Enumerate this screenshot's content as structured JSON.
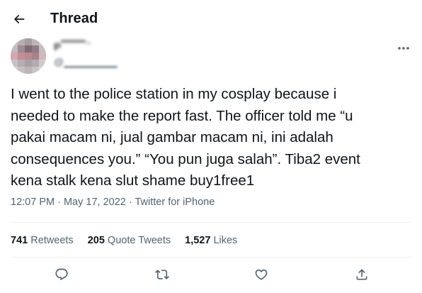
{
  "header": {
    "title": "Thread",
    "back_icon": "arrow-left-icon"
  },
  "author": {
    "display_name": "P▔▔▔ ̈",
    "handle": "@▁▁▁▁▁▁▁",
    "avatar_icon": "blurred-avatar",
    "more_icon": "more-horizontal-icon"
  },
  "tweet": {
    "text": "I went to the police station in my cosplay because i\nneeded to make the report fast. The officer told me “u\npakai macam ni, jual gambar macam ni, ini adalah\nconsequences you.” “You pun juga salah”. Tiba2 event\nkena stalk kena slut shame buy1free1",
    "time": "12:07 PM",
    "separator1": " · ",
    "date": "May 17, 2022",
    "separator2": " · ",
    "source": "Twitter for iPhone"
  },
  "stats": {
    "retweets_count": "741",
    "retweets_label": "Retweets",
    "quotes_count": "205",
    "quotes_label": "Quote Tweets",
    "likes_count": "1,527",
    "likes_label": "Likes"
  },
  "actions": {
    "reply_icon": "reply-icon",
    "retweet_icon": "retweet-icon",
    "like_icon": "heart-icon",
    "share_icon": "share-icon"
  },
  "colors": {
    "text_primary": "#0f1419",
    "text_secondary": "#536471",
    "divider": "#eff3f4"
  }
}
